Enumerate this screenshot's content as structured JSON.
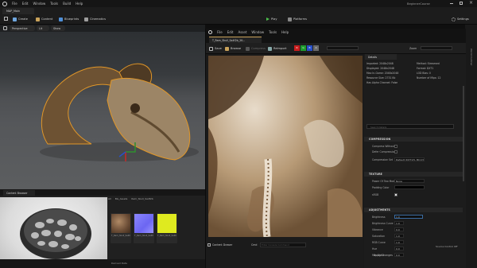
{
  "main_menu": [
    "File",
    "Edit",
    "Window",
    "Tools",
    "Build",
    "Help"
  ],
  "project_tab": "MAP_Main",
  "window_title": "BeginnerCourse",
  "toolbar": {
    "create": "Create",
    "content": "Content",
    "blueprints": "Blueprints",
    "cinematics": "Cinematics",
    "play": "Play",
    "platforms": "Platforms",
    "settings": "Settings"
  },
  "viewport": {
    "perspective": "Perspective",
    "lit": "Lit",
    "show": "Show"
  },
  "content_browser": {
    "tab": "Content Browser",
    "path": [
      "All",
      "BG_Assets",
      "Ram_Skull_Sa4f2b"
    ],
    "assets": [
      "T_Ram_Skull_Sa4f2b_2K_D",
      "T_Ram_Skull_Sa4f2b_2K_N",
      "T_Ram_Skull_Sa4f2b_2K_ORM"
    ]
  },
  "status": {
    "derived_data": "Derived Data",
    "source_control": "Source Control Off"
  },
  "texture_editor": {
    "menu": [
      "File",
      "Edit",
      "Asset",
      "Window",
      "Tools",
      "Help"
    ],
    "tab": "T_Ram_Skull_Sa4f2b_2K...",
    "toolbar": {
      "save": "Save",
      "browse": "Browse",
      "compress": "Compress",
      "reimport": "Reimport",
      "zoom_label": "Zoom"
    },
    "channels": [
      "R",
      "G",
      "B",
      "A"
    ],
    "channel_colors": [
      "#c81e1e",
      "#1e9b2d",
      "#2850c8",
      "#6a6a6a"
    ],
    "lower": {
      "content_drawer": "Content Drawer",
      "cmd": "Cmd",
      "cmd_placeholder": "Enter Console Command"
    },
    "details": {
      "tab": "Details",
      "search_placeholder": "Search Details",
      "info_left": [
        "Imported: 2048x2048",
        "Displayed: 2048x2048",
        "Max In-Game: 2048x2048",
        "Resource Size: 2731 Kb",
        "Has Alpha Channel: False"
      ],
      "info_right": [
        "Method: Streamed",
        "Format: DXT1",
        "LOD Bias: 0",
        "Number of Mips: 12"
      ],
      "compression": {
        "title": "COMPRESSION",
        "labels": [
          "Compress Without",
          "Defer Compression",
          "Compression Set"
        ],
        "compression_value": "Default (DXT1/5, BC1/3 on DX11)"
      },
      "texture": {
        "title": "TEXTURE",
        "labels": [
          "Power Of Two Mode",
          "Padding Color",
          "sRGB"
        ],
        "power_value": "None"
      },
      "adjustments": {
        "title": "ADJUSTMENTS",
        "labels": [
          "Brightness",
          "Brightness Curve",
          "Vibrance",
          "Saturation",
          "RGB Curve",
          "Hue",
          "Min Alpha"
        ],
        "values": [
          "1.0",
          "1.0",
          "0.0",
          "1.0",
          "1.0",
          "0.0",
          "0.0"
        ]
      },
      "apply_button": "Apply Changes"
    }
  },
  "side_label": "World Outliner"
}
